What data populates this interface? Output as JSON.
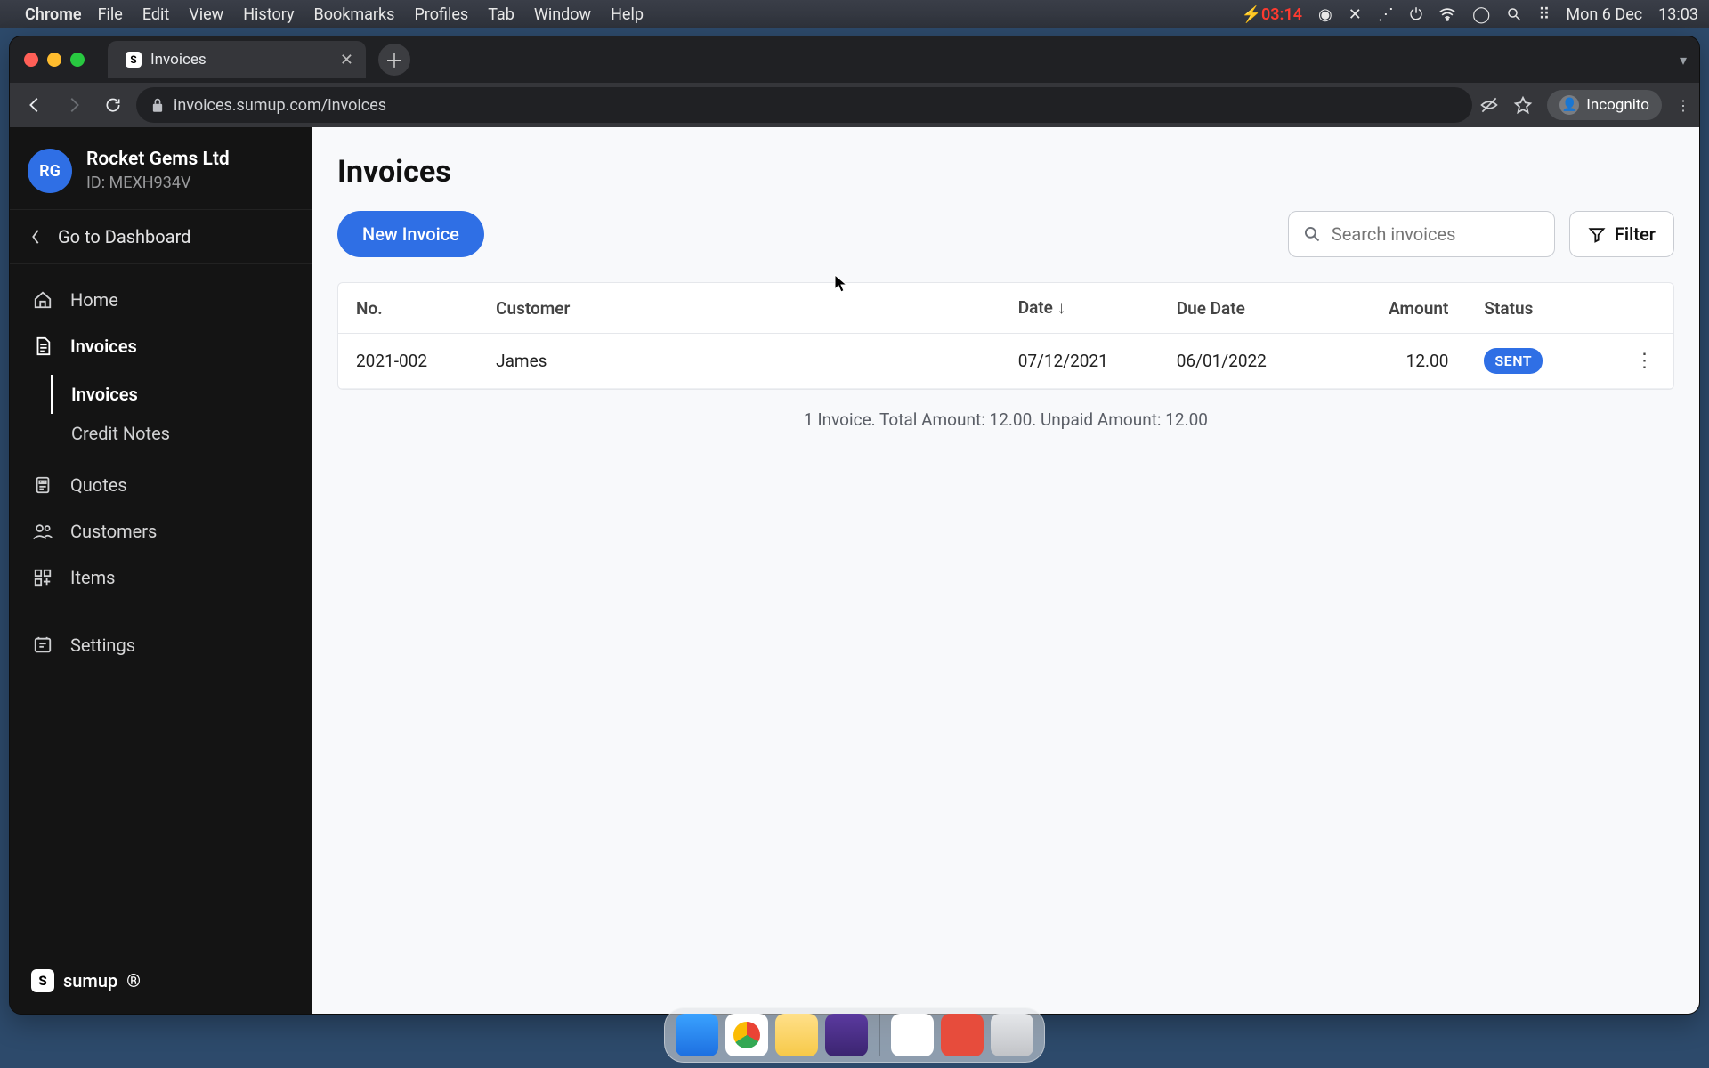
{
  "os": {
    "menubar": {
      "app": "Chrome",
      "items": [
        "File",
        "Edit",
        "View",
        "History",
        "Bookmarks",
        "Profiles",
        "Tab",
        "Window",
        "Help"
      ],
      "battery_indicator": "03:14",
      "date": "Mon 6 Dec",
      "time": "13:03"
    },
    "dock_items": [
      "finder",
      "chrome",
      "notes",
      "bolt",
      "doc",
      "rec",
      "trash"
    ]
  },
  "browser": {
    "tab_title": "Invoices",
    "url": "invoices.sumup.com/invoices",
    "mode_label": "Incognito"
  },
  "sidebar": {
    "org_initials": "RG",
    "org_name": "Rocket Gems Ltd",
    "org_id_label": "ID: MEXH934V",
    "go_dashboard": "Go to Dashboard",
    "items": [
      {
        "icon": "home-icon",
        "label": "Home"
      },
      {
        "icon": "invoices-icon",
        "label": "Invoices",
        "active": true,
        "children": [
          {
            "label": "Invoices",
            "active": true
          },
          {
            "label": "Credit Notes"
          }
        ]
      },
      {
        "icon": "quotes-icon",
        "label": "Quotes"
      },
      {
        "icon": "customers-icon",
        "label": "Customers"
      },
      {
        "icon": "items-icon",
        "label": "Items"
      },
      {
        "icon": "settings-icon",
        "label": "Settings"
      }
    ],
    "footer_label": "sumup"
  },
  "page": {
    "title": "Invoices",
    "new_invoice_label": "New Invoice",
    "search_placeholder": "Search invoices",
    "filter_label": "Filter"
  },
  "table": {
    "headers": {
      "no": "No.",
      "customer": "Customer",
      "date": "Date",
      "due": "Due Date",
      "amount": "Amount",
      "status": "Status"
    },
    "sort": {
      "column": "date",
      "dir": "desc"
    },
    "rows": [
      {
        "no": "2021-002",
        "customer": "James",
        "date": "07/12/2021",
        "due": "06/01/2022",
        "amount": "12.00",
        "status": "SENT"
      }
    ],
    "summary": "1 Invoice. Total Amount: 12.00. Unpaid Amount: 12.00"
  },
  "colors": {
    "primary": "#2f6fe5",
    "sidebar_bg": "#141414",
    "main_bg": "#f8f9fb"
  }
}
